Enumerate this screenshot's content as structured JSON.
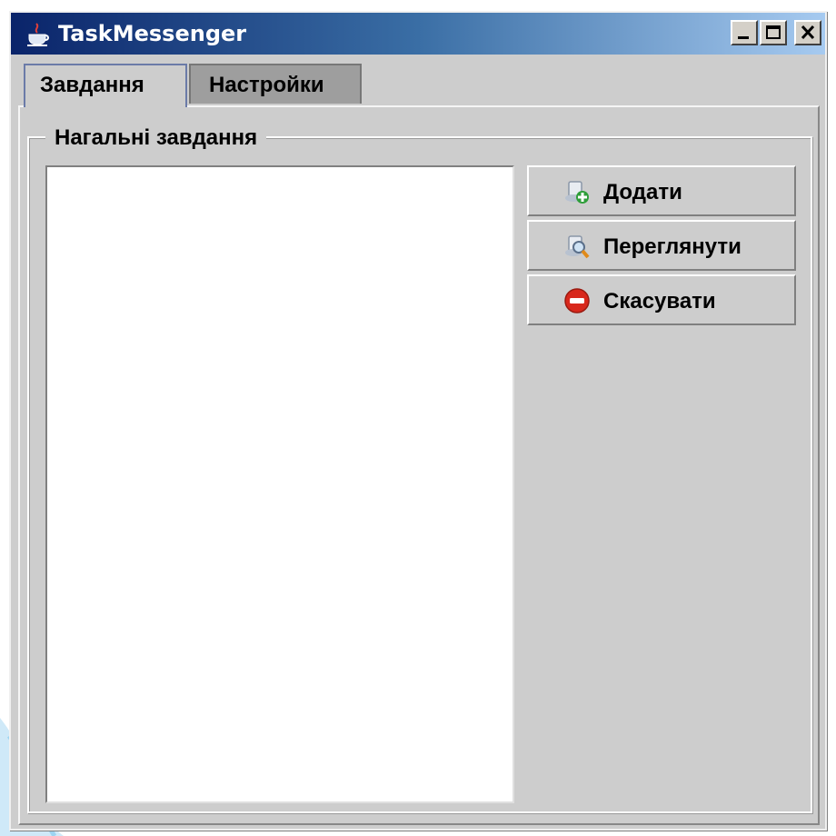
{
  "window": {
    "title": "TaskMessenger"
  },
  "title_buttons": {
    "minimize": "_",
    "maximize": "□",
    "close": "✕"
  },
  "tabs": [
    {
      "label": "Завдання",
      "active": true
    },
    {
      "label": "Настройки",
      "active": false
    }
  ],
  "group": {
    "title": "Нагальні завдання"
  },
  "task_list": {
    "items": []
  },
  "actions": [
    {
      "label": "Додати",
      "icon": "add-document-icon"
    },
    {
      "label": "Переглянути",
      "icon": "view-magnifier-icon"
    },
    {
      "label": "Скасувати",
      "icon": "cancel-stop-icon"
    }
  ],
  "colors": {
    "titlebar_start": "#0a246a",
    "titlebar_end": "#a6caf0",
    "panel_bg": "#cdcdcd",
    "cancel_red": "#d8281c"
  }
}
